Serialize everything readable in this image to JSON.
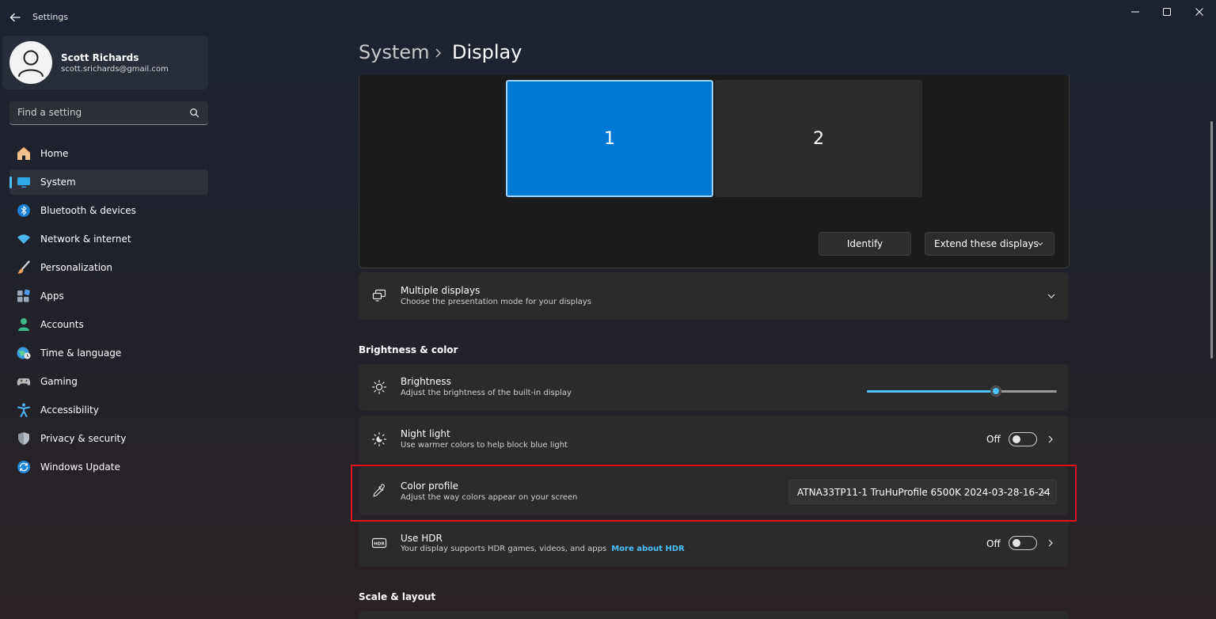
{
  "window": {
    "title": "Settings"
  },
  "user": {
    "name": "Scott Richards",
    "email": "scott.srichards@gmail.com"
  },
  "search": {
    "placeholder": "Find a setting"
  },
  "nav": {
    "items": [
      {
        "label": "Home",
        "icon": "home-icon"
      },
      {
        "label": "System",
        "icon": "system-icon",
        "active": true
      },
      {
        "label": "Bluetooth & devices",
        "icon": "bluetooth-icon"
      },
      {
        "label": "Network & internet",
        "icon": "wifi-icon"
      },
      {
        "label": "Personalization",
        "icon": "brush-icon"
      },
      {
        "label": "Apps",
        "icon": "apps-icon"
      },
      {
        "label": "Accounts",
        "icon": "accounts-icon"
      },
      {
        "label": "Time & language",
        "icon": "globe-clock-icon"
      },
      {
        "label": "Gaming",
        "icon": "gamepad-icon"
      },
      {
        "label": "Accessibility",
        "icon": "accessibility-icon"
      },
      {
        "label": "Privacy & security",
        "icon": "shield-icon"
      },
      {
        "label": "Windows Update",
        "icon": "update-icon"
      }
    ]
  },
  "breadcrumb": {
    "parent": "System",
    "current": "Display"
  },
  "displays": {
    "monitors": [
      "1",
      "2"
    ],
    "selected_monitor": "1",
    "identify_label": "Identify",
    "mode_value": "Extend these displays"
  },
  "multiple_displays": {
    "title": "Multiple displays",
    "subtitle": "Choose the presentation mode for your displays"
  },
  "brightness_color": {
    "section_title": "Brightness & color",
    "brightness": {
      "title": "Brightness",
      "subtitle": "Adjust the brightness of the built-in display",
      "level_percent": 68
    },
    "night_light": {
      "title": "Night light",
      "subtitle": "Use warmer colors to help block blue light",
      "state": "Off"
    },
    "color_profile": {
      "title": "Color profile",
      "subtitle": "Adjust the way colors appear on your screen",
      "value": "ATNA33TP11-1  TruHuProfile 6500K 2024-03-28-16-24"
    },
    "hdr": {
      "title": "Use HDR",
      "subtitle": "Your display supports HDR games, videos, and apps",
      "link": "More about HDR",
      "state": "Off"
    }
  },
  "scale_layout": {
    "section_title": "Scale & layout"
  },
  "colors": {
    "accent": "#4cc2ff",
    "selected_monitor": "#0078d4",
    "highlight": "#e3111f"
  }
}
